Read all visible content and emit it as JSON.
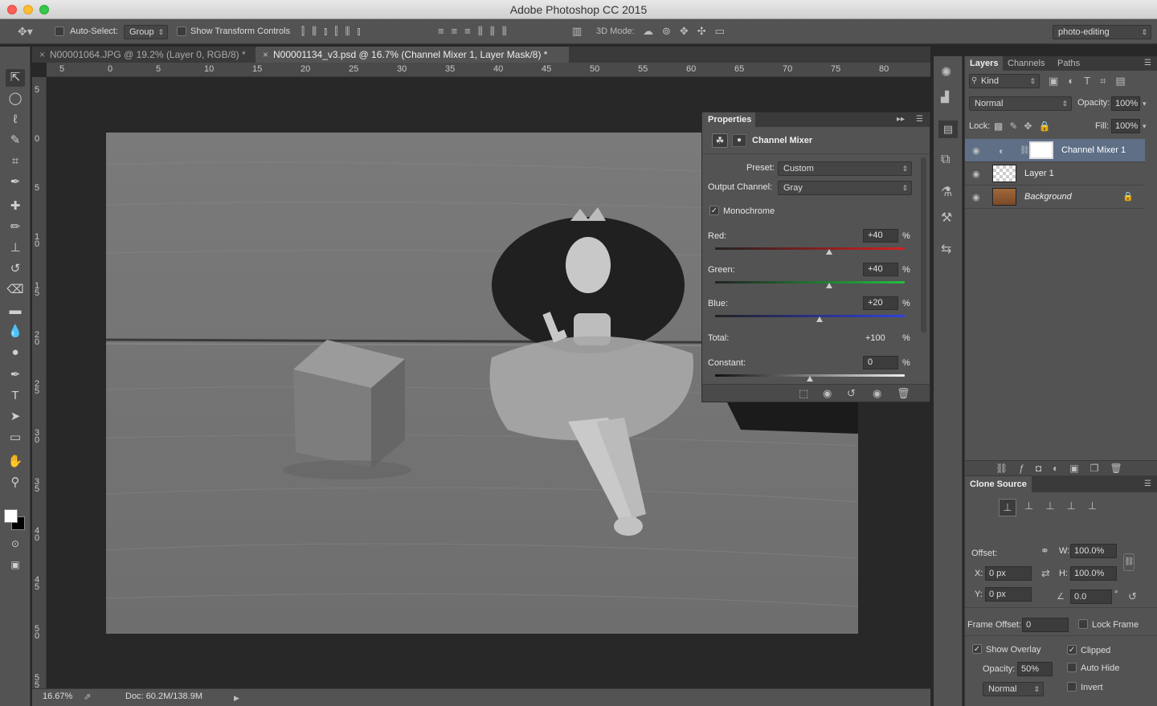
{
  "window": {
    "title": "Adobe Photoshop CC 2015"
  },
  "options_bar": {
    "auto_select_label": "Auto-Select:",
    "auto_select_value": "Group",
    "show_transform_label": "Show Transform Controls",
    "mode_3d_label": "3D Mode:",
    "workspace": "photo-editing"
  },
  "doc_tabs": [
    {
      "label": "N00001064.JPG @ 19.2% (Layer 0, RGB/8) *"
    },
    {
      "label": "N00001134_v3.psd @ 16.7% (Channel Mixer 1, Layer Mask/8) *"
    }
  ],
  "rulers": {
    "h_ticks": [
      "5",
      "0",
      "5",
      "10",
      "15",
      "20",
      "25",
      "30",
      "35",
      "40",
      "45",
      "50",
      "55",
      "60",
      "65",
      "70",
      "75",
      "80"
    ],
    "v_ticks": [
      "5",
      "0",
      "5",
      "1\n0",
      "1\n5",
      "2\n0",
      "2\n5",
      "3\n0",
      "3\n5",
      "4\n0",
      "4\n5",
      "5\n0",
      "5\n5"
    ]
  },
  "status": {
    "zoom": "16.67%",
    "doc_size": "Doc: 60.2M/138.9M"
  },
  "properties": {
    "panel_title": "Properties",
    "adjustment": "Channel Mixer",
    "preset_label": "Preset:",
    "preset_value": "Custom",
    "output_label": "Output Channel:",
    "output_value": "Gray",
    "monochrome_label": "Monochrome",
    "monochrome": true,
    "red_label": "Red:",
    "red": "+40",
    "green_label": "Green:",
    "green": "+40",
    "blue_label": "Blue:",
    "blue": "+20",
    "total_label": "Total:",
    "total": "+100",
    "constant_label": "Constant:",
    "constant": "0",
    "percent": "%",
    "slider_levels": {
      "red": 0.6,
      "green": 0.6,
      "blue": 0.55,
      "constant": 0.5
    }
  },
  "layers_panel": {
    "tabs": [
      "Layers",
      "Channels",
      "Paths"
    ],
    "filter": "Kind",
    "blend_mode": "Normal",
    "opacity_label": "Opacity:",
    "opacity": "100%",
    "lock_label": "Lock:",
    "fill_label": "Fill:",
    "fill": "100%",
    "layers": [
      {
        "name": "Channel Mixer 1"
      },
      {
        "name": "Layer 1"
      },
      {
        "name": "Background"
      }
    ]
  },
  "clone_source": {
    "title": "Clone Source",
    "offset_label": "Offset:",
    "x_label": "X:",
    "x": "0 px",
    "y_label": "Y:",
    "y": "0 px",
    "w_label": "W:",
    "w": "100.0%",
    "h_label": "H:",
    "h": "100.0%",
    "angle": "0.0",
    "degree": "°",
    "frame_offset_label": "Frame Offset:",
    "frame_offset": "0",
    "lock_frame_label": "Lock Frame",
    "show_overlay_label": "Show Overlay",
    "clipped_label": "Clipped",
    "opacity_label": "Opacity:",
    "opacity": "50%",
    "auto_hide_label": "Auto Hide",
    "blend": "Normal",
    "invert_label": "Invert"
  }
}
